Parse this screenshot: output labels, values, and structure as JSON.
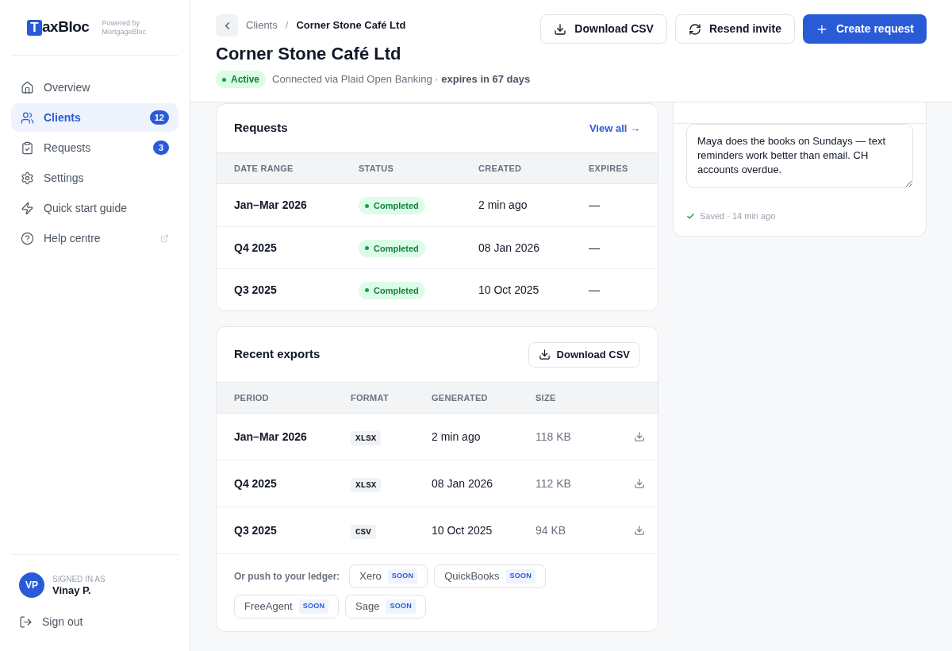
{
  "logo": {
    "mark": "T",
    "text": "axBloc",
    "powered": "Powered by",
    "powered_brand": "MortgageBloc"
  },
  "nav": [
    {
      "label": "Overview",
      "selected": false,
      "external": false
    },
    {
      "label": "Clients",
      "selected": true,
      "external": false,
      "badge": "12"
    },
    {
      "label": "Requests",
      "selected": false,
      "external": false,
      "badge": "3"
    },
    {
      "label": "Settings",
      "selected": false,
      "external": false
    },
    {
      "label": "Quick start guide",
      "selected": false,
      "external": false
    },
    {
      "label": "Help centre",
      "selected": false,
      "external": true
    }
  ],
  "user": {
    "initials": "VP",
    "caption": "SIGNED IN AS",
    "name": "Vinay P."
  },
  "sign_out": "Sign out",
  "breadcrumb": {
    "parent": "Clients",
    "separator": "/",
    "current": "Corner Stone Café Ltd"
  },
  "title": "Corner Stone Café Ltd",
  "status": {
    "label": "Active",
    "text": "Connected via Plaid Open Banking ·",
    "expiry": "expires in 67 days"
  },
  "actions": [
    {
      "label": "Download CSV",
      "primary": false
    },
    {
      "label": "Resend invite",
      "primary": false
    },
    {
      "label": "Create request",
      "primary": true
    }
  ],
  "requests": {
    "title": "Requests",
    "link": "View all →",
    "columns": [
      "DATE RANGE",
      "STATUS",
      "CREATED",
      "EXPIRES"
    ],
    "rows": [
      {
        "range": "Jan–Mar 2026",
        "status": "Completed",
        "created": "2 min ago",
        "expires": "—"
      },
      {
        "range": "Q4 2025",
        "status": "Completed",
        "created": "08 Jan 2026",
        "expires": "—"
      },
      {
        "range": "Q3 2025",
        "status": "Completed",
        "created": "10 Oct 2025",
        "expires": "—"
      }
    ]
  },
  "exports": {
    "title": "Recent exports",
    "button": "Download CSV",
    "columns": [
      "PERIOD",
      "FORMAT",
      "GENERATED",
      "SIZE"
    ],
    "rows": [
      {
        "period": "Jan–Mar 2026",
        "format": "XLSX",
        "generated": "2 min ago",
        "size": "118 KB"
      },
      {
        "period": "Q4 2025",
        "format": "XLSX",
        "generated": "08 Jan 2026",
        "size": "112 KB"
      },
      {
        "period": "Q3 2025",
        "format": "CSV",
        "generated": "10 Oct 2025",
        "size": "94 KB"
      }
    ],
    "ledger_label": "Or push to your ledger:",
    "ledgers": [
      {
        "name": "Xero",
        "tag": "SOON"
      },
      {
        "name": "QuickBooks",
        "tag": "SOON"
      },
      {
        "name": "FreeAgent",
        "tag": "SOON"
      },
      {
        "name": "Sage",
        "tag": "SOON"
      }
    ]
  },
  "notes": {
    "value": "Maya does the books on Sundays — text reminders work better than email. CH accounts overdue.",
    "saved": "Saved · 14 min ago"
  }
}
